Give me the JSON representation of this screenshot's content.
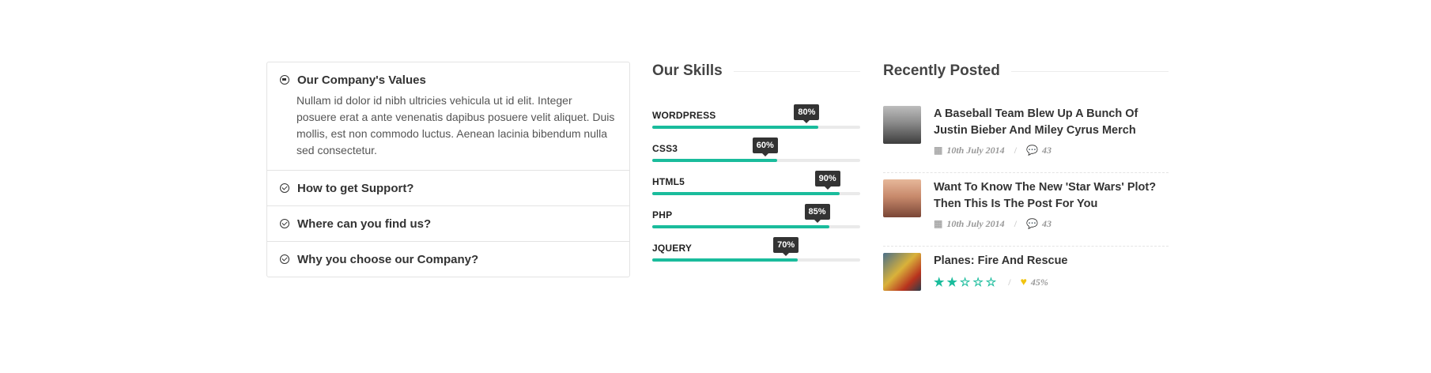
{
  "accordion": {
    "items": [
      {
        "title": "Our Company's Values",
        "body": "Nullam id dolor id nibh ultricies vehicula ut id elit. Integer posuere erat a ante venenatis dapibus posuere velit aliquet. Duis mollis, est non commodo luctus. Aenean lacinia bibendum nulla sed consectetur."
      },
      {
        "title": "How to get Support?"
      },
      {
        "title": "Where can you find us?"
      },
      {
        "title": "Why you choose our Company?"
      }
    ]
  },
  "skills": {
    "title": "Our Skills",
    "items": [
      {
        "name": "WORDPRESS",
        "percent": 80,
        "label": "80%"
      },
      {
        "name": "CSS3",
        "percent": 60,
        "label": "60%"
      },
      {
        "name": "HTML5",
        "percent": 90,
        "label": "90%"
      },
      {
        "name": "PHP",
        "percent": 85,
        "label": "85%"
      },
      {
        "name": "JQUERY",
        "percent": 70,
        "label": "70%"
      }
    ]
  },
  "recent": {
    "title": "Recently Posted",
    "posts": [
      {
        "title": "A Baseball Team Blew Up A Bunch Of Justin Bieber And Miley Cyrus Merch",
        "date": "10th July 2014",
        "comments": "43",
        "thumb_icon": "stadium-photo"
      },
      {
        "title": "Want To Know The New 'Star Wars' Plot? Then This Is The Post For You",
        "date": "10th July 2014",
        "comments": "43",
        "thumb_icon": "bridge-photo"
      },
      {
        "title": "Planes: Fire And Rescue",
        "rating": 2,
        "rating_max": 5,
        "likes": "45%",
        "thumb_icon": "planes-photo"
      }
    ]
  },
  "colors": {
    "accent": "#1abc9c",
    "heart": "#f1c40f",
    "tooltip": "#333333"
  }
}
